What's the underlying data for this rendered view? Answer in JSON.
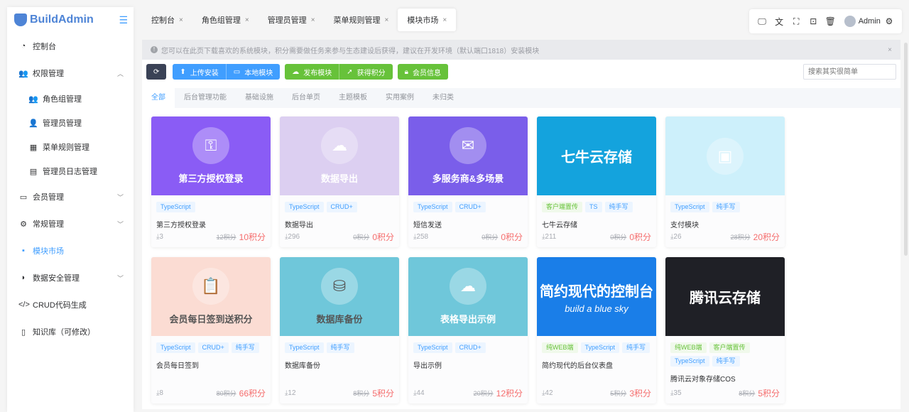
{
  "app": {
    "name": "BuildAdmin"
  },
  "sidebar": {
    "items": [
      {
        "label": "控制台",
        "icon": "dashboard-icon",
        "glyph": "◔"
      },
      {
        "label": "权限管理",
        "icon": "users-icon",
        "glyph": "👥",
        "arrow": "︿"
      },
      {
        "label": "角色组管理",
        "icon": "group-icon",
        "glyph": "👥",
        "sub": true
      },
      {
        "label": "管理员管理",
        "icon": "user-icon",
        "glyph": "👤",
        "sub": true
      },
      {
        "label": "菜单规则管理",
        "icon": "grid-icon",
        "glyph": "▦",
        "sub": true
      },
      {
        "label": "管理员日志管理",
        "icon": "clipboard-icon",
        "glyph": "▤",
        "sub": true
      },
      {
        "label": "会员管理",
        "icon": "id-card-icon",
        "glyph": "▭",
        "arrow": "﹀"
      },
      {
        "label": "常规管理",
        "icon": "gears-icon",
        "glyph": "⚙",
        "arrow": "﹀"
      },
      {
        "label": "模块市场",
        "icon": "module-icon",
        "glyph": "▪",
        "active": true
      },
      {
        "label": "数据安全管理",
        "icon": "shield-icon",
        "glyph": "◗",
        "arrow": "﹀"
      },
      {
        "label": "CRUD代码生成",
        "icon": "code-icon",
        "glyph": "</>"
      },
      {
        "label": "知识库（可修改）",
        "icon": "book-icon",
        "glyph": "▯"
      }
    ]
  },
  "tabs": [
    {
      "label": "控制台"
    },
    {
      "label": "角色组管理"
    },
    {
      "label": "管理员管理"
    },
    {
      "label": "菜单规则管理"
    },
    {
      "label": "模块市场",
      "active": true
    }
  ],
  "topbar": {
    "user": "Admin"
  },
  "notice": {
    "text": "您可以在此页下载喜欢的系统模块，积分需要做任务来参与生态建设后获得，建议在开发环境（默认端口1818）安装模块"
  },
  "toolbar": {
    "upload": "上传安装",
    "local": "本地模块",
    "publish": "发布模块",
    "points": "获得积分",
    "member": "会员信息",
    "search_placeholder": "搜索其实很简单"
  },
  "colors": {
    "primary": "#409eff",
    "success": "#67c23a",
    "dark": "#3a4256",
    "danger": "#f56c6c"
  },
  "categories": [
    {
      "label": "全部",
      "active": true
    },
    {
      "label": "后台管理功能"
    },
    {
      "label": "基础设施"
    },
    {
      "label": "后台单页"
    },
    {
      "label": "主题模板"
    },
    {
      "label": "实用案例"
    },
    {
      "label": "未归类"
    }
  ],
  "modules": [
    {
      "banner": "第三方授权登录",
      "bg": "#8a5cf5",
      "glyph": "⚿",
      "tags": [
        [
          "TypeScript",
          "blue"
        ]
      ],
      "name": "第三方授权登录",
      "downloads": "3",
      "old_price": "12积分",
      "price": "10积分"
    },
    {
      "banner": "数据导出",
      "bg": "#dccff1",
      "glyph": "☁",
      "tags": [
        [
          "TypeScript",
          "blue"
        ],
        [
          "CRUD+",
          "blue"
        ]
      ],
      "name": "数据导出",
      "downloads": "296",
      "old_price": "0积分",
      "price": "0积分"
    },
    {
      "banner": "多服务商&多场景",
      "bg": "#7a5eea",
      "glyph": "✉",
      "tags": [
        [
          "TypeScript",
          "blue"
        ],
        [
          "CRUD+",
          "blue"
        ]
      ],
      "name": "短信发送",
      "downloads": "258",
      "old_price": "0积分",
      "price": "0积分"
    },
    {
      "banner": "七牛云存储",
      "bg": "#14a3dd",
      "big": true,
      "tags": [
        [
          "客户端置传",
          "green"
        ],
        [
          "TS",
          "blue"
        ],
        [
          "纯手写",
          "blue"
        ]
      ],
      "name": "七牛云存储",
      "downloads": "211",
      "old_price": "0积分",
      "price": "0积分"
    },
    {
      "banner": "",
      "bg": "#cdf0fb",
      "glyph": "▣",
      "tags": [
        [
          "TypeScript",
          "blue"
        ],
        [
          "纯手写",
          "blue"
        ]
      ],
      "name": "支付模块",
      "downloads": "26",
      "old_price": "28积分",
      "price": "20积分"
    },
    {
      "banner": "会员每日签到送积分",
      "bg": "#fbdcd3",
      "glyph": "📋",
      "dark": true,
      "tags": [
        [
          "TypeScript",
          "blue"
        ],
        [
          "CRUD+",
          "blue"
        ],
        [
          "纯手写",
          "blue"
        ]
      ],
      "name": "会员每日签到",
      "downloads": "8",
      "old_price": "80积分",
      "price": "66积分"
    },
    {
      "banner": "数据库备份",
      "bg": "#6fc7da",
      "glyph": "⛁",
      "dark": true,
      "tags": [
        [
          "TypeScript",
          "blue"
        ],
        [
          "纯手写",
          "blue"
        ]
      ],
      "name": "数据库备份",
      "downloads": "12",
      "old_price": "8积分",
      "price": "5积分"
    },
    {
      "banner": "表格导出示例",
      "bg": "#6fc7da",
      "glyph": "☁",
      "tags": [
        [
          "TypeScript",
          "blue"
        ],
        [
          "CRUD+",
          "blue"
        ]
      ],
      "name": "导出示例",
      "downloads": "44",
      "old_price": "20积分",
      "price": "12积分"
    },
    {
      "banner": "简约现代的控制台",
      "subtitle": "build a blue sky",
      "bg": "#1a7ee8",
      "big": true,
      "tags": [
        [
          "纯WEB端",
          "green"
        ],
        [
          "TypeScript",
          "blue"
        ],
        [
          "纯手写",
          "blue"
        ]
      ],
      "name": "简约现代的后台仪表盘",
      "downloads": "42",
      "old_price": "5积分",
      "price": "3积分"
    },
    {
      "banner": "腾讯云存储",
      "bg": "#1f2026",
      "big": true,
      "tags": [
        [
          "纯WEB端",
          "green"
        ],
        [
          "客户端置传",
          "green"
        ],
        [
          "TypeScript",
          "blue"
        ],
        [
          "纯手写",
          "blue"
        ]
      ],
      "name": "腾讯云对象存储COS",
      "downloads": "35",
      "old_price": "8积分",
      "price": "5积分"
    }
  ]
}
